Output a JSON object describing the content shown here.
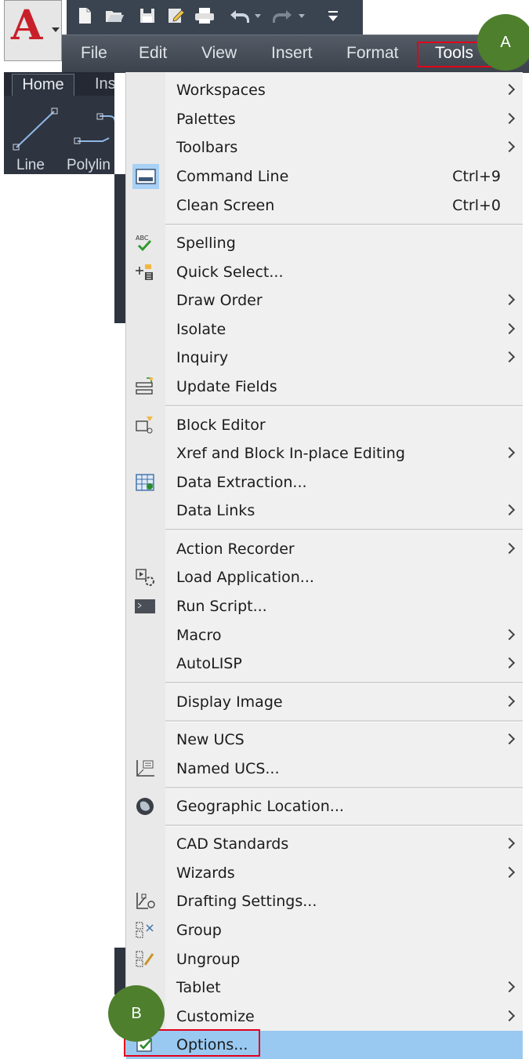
{
  "app": {
    "logo_letter": "A"
  },
  "menubar": {
    "items": [
      "File",
      "Edit",
      "View",
      "Insert",
      "Format",
      "Tools"
    ]
  },
  "ribbon": {
    "tabs": [
      "Home",
      "Ins"
    ],
    "tools": [
      "Line",
      "Polylin"
    ]
  },
  "menu": {
    "items": [
      {
        "label": "Workspaces",
        "submenu": true
      },
      {
        "label": "Palettes",
        "submenu": true
      },
      {
        "label": "Toolbars",
        "submenu": true
      },
      {
        "label": "Command Line",
        "shortcut": "Ctrl+9",
        "icon": "command-line-icon"
      },
      {
        "label": "Clean Screen",
        "shortcut": "Ctrl+0"
      },
      {
        "label": "Spelling",
        "icon": "spelling-icon"
      },
      {
        "label": "Quick Select...",
        "icon": "quick-select-icon"
      },
      {
        "label": "Draw Order",
        "submenu": true
      },
      {
        "label": "Isolate",
        "submenu": true
      },
      {
        "label": "Inquiry",
        "submenu": true
      },
      {
        "label": "Update Fields",
        "icon": "update-fields-icon"
      },
      {
        "label": "Block Editor",
        "icon": "block-editor-icon"
      },
      {
        "label": "Xref and Block In-place Editing",
        "submenu": true
      },
      {
        "label": "Data Extraction...",
        "icon": "data-extraction-icon"
      },
      {
        "label": "Data Links",
        "submenu": true
      },
      {
        "label": "Action Recorder",
        "submenu": true
      },
      {
        "label": "Load Application...",
        "icon": "load-application-icon"
      },
      {
        "label": "Run Script...",
        "icon": "run-script-icon"
      },
      {
        "label": "Macro",
        "submenu": true
      },
      {
        "label": "AutoLISP",
        "submenu": true
      },
      {
        "label": "Display Image",
        "submenu": true
      },
      {
        "label": "New UCS",
        "submenu": true
      },
      {
        "label": "Named UCS...",
        "icon": "named-ucs-icon"
      },
      {
        "label": "Geographic Location...",
        "icon": "globe-icon"
      },
      {
        "label": "CAD Standards",
        "submenu": true
      },
      {
        "label": "Wizards",
        "submenu": true
      },
      {
        "label": "Drafting Settings...",
        "icon": "drafting-settings-icon"
      },
      {
        "label": "Group",
        "icon": "group-icon"
      },
      {
        "label": "Ungroup",
        "icon": "ungroup-icon"
      },
      {
        "label": "Tablet",
        "submenu": true
      },
      {
        "label": "Customize",
        "submenu": true
      },
      {
        "label": "Options...",
        "icon": "options-icon",
        "selected": true
      }
    ]
  },
  "callouts": {
    "a": "A",
    "b": "B"
  },
  "colors": {
    "highlight_box": "#e3001b",
    "callout_fill": "#4e7f2d",
    "selected_row": "#99c9f1"
  }
}
